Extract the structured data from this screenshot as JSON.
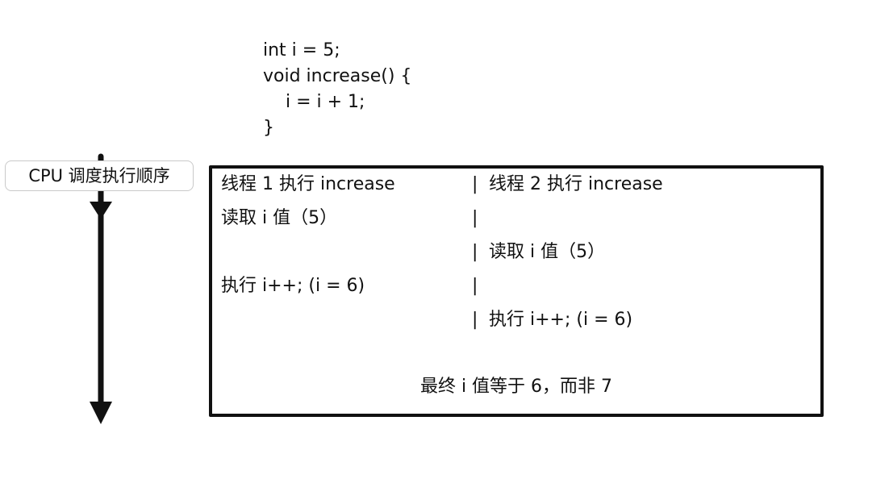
{
  "code": {
    "lines": [
      "int i = 5;",
      "void increase() {",
      "    i = i + 1;",
      "}"
    ]
  },
  "cpu_label": "CPU 调度执行顺序",
  "separator": "|",
  "rows": [
    {
      "left": "线程 1 执行 increase",
      "right": "线程 2 执行 increase"
    },
    {
      "left": "读取 i 值（5）",
      "right": ""
    },
    {
      "left": "",
      "right": "读取 i 值（5）"
    },
    {
      "left": "执行 i++; (i = 6)",
      "right": ""
    },
    {
      "left": "",
      "right": "执行 i++; (i = 6)"
    }
  ],
  "conclusion": "最终 i 值等于 6，而非 7"
}
